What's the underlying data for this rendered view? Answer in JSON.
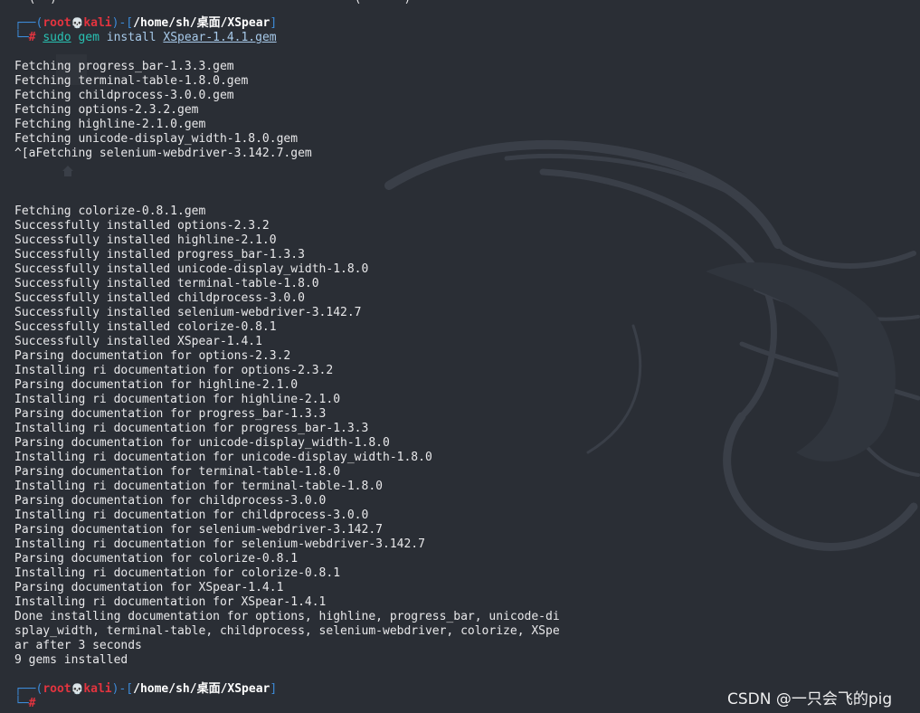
{
  "top_partial": "──(  )──  ──             ─  ──     ─ ─  ─  ─  ──(  ─  ─) ─",
  "prompt1": {
    "user": "root",
    "skull": "💀",
    "host": "kali",
    "path": "/home/sh/桌面/XSpear",
    "hash": "#",
    "cmd_sudo": "sudo",
    "cmd_gem": "gem",
    "cmd_install": "install",
    "cmd_file": "XSpear-1.4.1.gem"
  },
  "output_block1": [
    "Fetching progress_bar-1.3.3.gem",
    "Fetching terminal-table-1.8.0.gem",
    "Fetching childprocess-3.0.0.gem",
    "Fetching options-2.3.2.gem",
    "Fetching highline-2.1.0.gem",
    "Fetching unicode-display_width-1.8.0.gem",
    "^[aFetching selenium-webdriver-3.142.7.gem"
  ],
  "output_block2": [
    "Fetching colorize-0.8.1.gem",
    "Successfully installed options-2.3.2",
    "Successfully installed highline-2.1.0",
    "Successfully installed progress_bar-1.3.3",
    "Successfully installed unicode-display_width-1.8.0",
    "Successfully installed terminal-table-1.8.0",
    "Successfully installed childprocess-3.0.0",
    "Successfully installed selenium-webdriver-3.142.7",
    "Successfully installed colorize-0.8.1",
    "Successfully installed XSpear-1.4.1",
    "Parsing documentation for options-2.3.2",
    "Installing ri documentation for options-2.3.2",
    "Parsing documentation for highline-2.1.0",
    "Installing ri documentation for highline-2.1.0",
    "Parsing documentation for progress_bar-1.3.3",
    "Installing ri documentation for progress_bar-1.3.3",
    "Parsing documentation for unicode-display_width-1.8.0",
    "Installing ri documentation for unicode-display_width-1.8.0",
    "Parsing documentation for terminal-table-1.8.0",
    "Installing ri documentation for terminal-table-1.8.0",
    "Parsing documentation for childprocess-3.0.0",
    "Installing ri documentation for childprocess-3.0.0",
    "Parsing documentation for selenium-webdriver-3.142.7",
    "Installing ri documentation for selenium-webdriver-3.142.7",
    "Parsing documentation for colorize-0.8.1",
    "Installing ri documentation for colorize-0.8.1",
    "Parsing documentation for XSpear-1.4.1",
    "Installing ri documentation for XSpear-1.4.1",
    "Done installing documentation for options, highline, progress_bar, unicode-di",
    "splay_width, terminal-table, childprocess, selenium-webdriver, colorize, XSpe",
    "ar after 3 seconds",
    "9 gems installed"
  ],
  "prompt2": {
    "user": "root",
    "skull": "💀",
    "host": "kali",
    "path": "/home/sh/桌面/XSpear",
    "hash": "#"
  },
  "watermark": "CSDN @一只会飞的pig",
  "colors": {
    "background": "#2a2e35",
    "prompt_frame": "#3d8ad8",
    "user_host": "#e3343f",
    "command": "#28c2b3",
    "text": "#e8e8ea"
  },
  "icons": {
    "skull": "skull-icon",
    "ghost_home": "home-icon"
  }
}
